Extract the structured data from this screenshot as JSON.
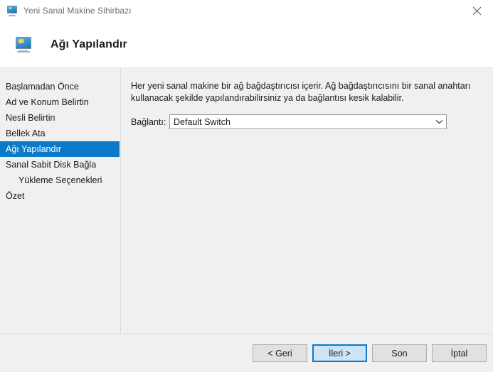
{
  "window": {
    "title": "Yeni Sanal Makine Sihirbazı",
    "title_icon": "virtual-machine-monitor-icon",
    "close_label": "×"
  },
  "header": {
    "title": "Ağı Yapılandır",
    "icon": "network-monitor-icon"
  },
  "sidebar": {
    "items": [
      {
        "label": "Başlamadan Önce",
        "selected": false,
        "sub": false
      },
      {
        "label": "Ad ve Konum Belirtin",
        "selected": false,
        "sub": false
      },
      {
        "label": "Nesli Belirtin",
        "selected": false,
        "sub": false
      },
      {
        "label": "Bellek Ata",
        "selected": false,
        "sub": false
      },
      {
        "label": "Ağı Yapılandır",
        "selected": true,
        "sub": false
      },
      {
        "label": "Sanal Sabit Disk Bağla",
        "selected": false,
        "sub": false
      },
      {
        "label": "Yükleme Seçenekleri",
        "selected": false,
        "sub": true
      },
      {
        "label": "Özet",
        "selected": false,
        "sub": false
      }
    ]
  },
  "content": {
    "description": "Her yeni sanal makine bir ağ bağdaştırıcısı içerir. Ağ bağdaştırıcısını bir sanal anahtarı kullanacak şekilde yapılandırabilirsiniz ya da bağlantısı kesik kalabilir.",
    "connection": {
      "label": "Bağlantı:",
      "value": "Default Switch",
      "options": [
        "Default Switch"
      ]
    }
  },
  "footer": {
    "buttons": [
      {
        "label": "< Geri",
        "focused": false
      },
      {
        "label": "İleri >",
        "focused": true
      },
      {
        "label": "Son",
        "focused": false
      },
      {
        "label": "İptal",
        "focused": false
      }
    ]
  },
  "colors": {
    "accent": "#0b7ac9",
    "window_bg": "#f0f0f0",
    "titlebar_bg": "#ffffff",
    "selected_text": "#ffffff",
    "focus_button_bg": "#cce4f7"
  }
}
